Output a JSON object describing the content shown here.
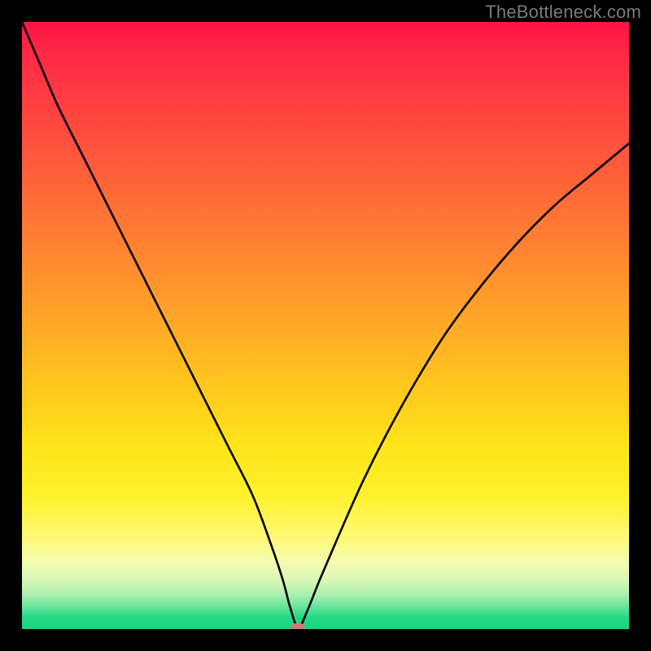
{
  "watermark": "TheBottleneck.com",
  "chart_data": {
    "type": "line",
    "title": "",
    "xlabel": "",
    "ylabel": "",
    "xlim": [
      0,
      100
    ],
    "ylim": [
      0,
      100
    ],
    "grid": false,
    "legend": false,
    "background": "rainbow-gradient",
    "series": [
      {
        "name": "bottleneck-curve",
        "x": [
          0,
          3,
          6,
          10,
          14,
          18,
          22,
          26,
          30,
          34,
          38,
          41,
          43,
          44.2,
          45.5,
          47,
          49,
          52,
          56,
          60,
          65,
          70,
          76,
          82,
          88,
          94,
          100
        ],
        "y": [
          100,
          93,
          86,
          78,
          70,
          62,
          54,
          46,
          38,
          30,
          22,
          14,
          8,
          3.5,
          0.2,
          3,
          8,
          15,
          24,
          32,
          41,
          49,
          57,
          64,
          70,
          75,
          80
        ]
      }
    ],
    "marker": {
      "x": 45.5,
      "y": 0.2,
      "color": "#cf7a78"
    }
  }
}
